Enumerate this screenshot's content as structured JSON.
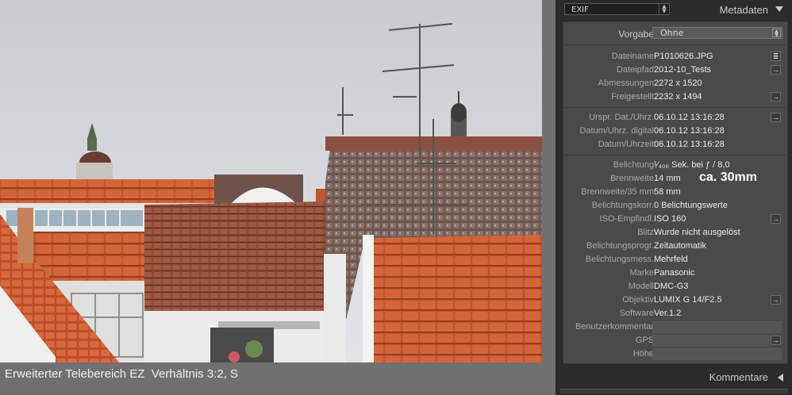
{
  "photo": {
    "caption": "Erweiterter Telebereich EZ  Verhältnis 3:2, S"
  },
  "panel": {
    "view_select": "EXIF",
    "title": "Metadaten",
    "preset_label": "Vorgabe",
    "preset_value": "Ohne",
    "rows_file": [
      {
        "label": "Dateiname",
        "value": "P1010626.JPG",
        "button": "list"
      },
      {
        "label": "Dateipfad",
        "value": "2012-10_Tests",
        "button": "arrow"
      },
      {
        "label": "Abmessungen",
        "value": "2272 x 1520",
        "button": ""
      },
      {
        "label": "Freigestellt",
        "value": "2232 x 1494",
        "button": "arrow"
      }
    ],
    "rows_date": [
      {
        "label": "Urspr. Dat./Uhrz.",
        "value": "06.10.12 13:16:28",
        "button": "arrow"
      },
      {
        "label": "Datum/Uhrz. digital",
        "value": "06.10.12 13:16:28",
        "button": ""
      },
      {
        "label": "Datum/Uhrzeit",
        "value": "06.10.12 13:16:28",
        "button": ""
      }
    ],
    "rows_exif": [
      {
        "label": "Belichtung",
        "value": "¹⁄₄₀₀ Sek. bei ƒ / 8,0",
        "button": ""
      },
      {
        "label": "Brennweite",
        "value": "14 mm",
        "button": ""
      },
      {
        "label": "Brennweite/35 mm",
        "value": "58 mm",
        "button": ""
      },
      {
        "label": "Belichtungskorr.",
        "value": "0 Belichtungswerte",
        "button": ""
      },
      {
        "label": "ISO-Empfindl.",
        "value": "ISO 160",
        "button": "arrow"
      },
      {
        "label": "Blitz",
        "value": "Wurde nicht ausgelöst",
        "button": ""
      },
      {
        "label": "Belichtungsprogr.",
        "value": "Zeitautomatik",
        "button": ""
      },
      {
        "label": "Belichtungsmess.",
        "value": "Mehrfeld",
        "button": ""
      },
      {
        "label": "Marke",
        "value": "Panasonic",
        "button": ""
      },
      {
        "label": "Modell",
        "value": "DMC-G3",
        "button": ""
      },
      {
        "label": "Objektiv",
        "value": "LUMIX G 14/F2.5",
        "button": "arrow"
      },
      {
        "label": "Software",
        "value": "Ver.1.2",
        "button": ""
      },
      {
        "label": "Benutzerkommentar",
        "value": "",
        "button": "field"
      },
      {
        "label": "GPS",
        "value": "",
        "button": "field-arrow"
      },
      {
        "label": "Höhe",
        "value": "",
        "button": "field"
      }
    ],
    "annotation": "ca. 30mm",
    "comments_title": "Kommentare"
  },
  "icons": {
    "list_button": "list-icon",
    "arrow_button": "arrow-right-icon",
    "collapse": "triangle-down-icon",
    "expand": "triangle-left-icon"
  },
  "colors": {
    "panel_bg": "#2b2b2b",
    "section_bg": "#4a4a4a",
    "label_text": "#a8a8a8",
    "value_text": "#eaeaea"
  }
}
